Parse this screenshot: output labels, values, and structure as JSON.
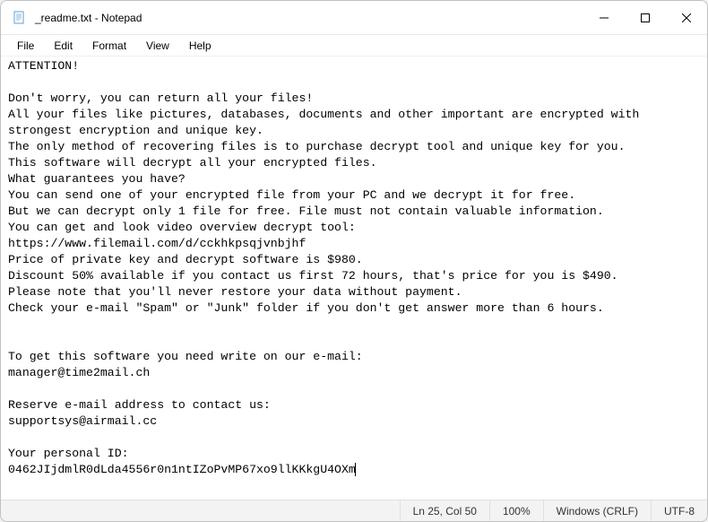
{
  "titlebar": {
    "title": "_readme.txt - Notepad",
    "icon": "notepad-icon"
  },
  "window_controls": {
    "minimize": "minimize",
    "maximize": "maximize",
    "close": "close"
  },
  "menubar": {
    "items": [
      "File",
      "Edit",
      "Format",
      "View",
      "Help"
    ]
  },
  "document": {
    "text": "ATTENTION!\n\nDon't worry, you can return all your files!\nAll your files like pictures, databases, documents and other important are encrypted with strongest encryption and unique key.\nThe only method of recovering files is to purchase decrypt tool and unique key for you.\nThis software will decrypt all your encrypted files.\nWhat guarantees you have?\nYou can send one of your encrypted file from your PC and we decrypt it for free.\nBut we can decrypt only 1 file for free. File must not contain valuable information.\nYou can get and look video overview decrypt tool:\nhttps://www.filemail.com/d/cckhkpsqjvnbjhf\nPrice of private key and decrypt software is $980.\nDiscount 50% available if you contact us first 72 hours, that's price for you is $490.\nPlease note that you'll never restore your data without payment.\nCheck your e-mail \"Spam\" or \"Junk\" folder if you don't get answer more than 6 hours.\n\n\nTo get this software you need write on our e-mail:\nmanager@time2mail.ch\n\nReserve e-mail address to contact us:\nsupportsys@airmail.cc\n\nYour personal ID:\n0462JIjdmlR0dLda4556r0n1ntIZoPvMP67xo9llKKkgU4OXm"
  },
  "statusbar": {
    "position": "Ln 25, Col 50",
    "zoom": "100%",
    "line_endings": "Windows (CRLF)",
    "encoding": "UTF-8"
  }
}
